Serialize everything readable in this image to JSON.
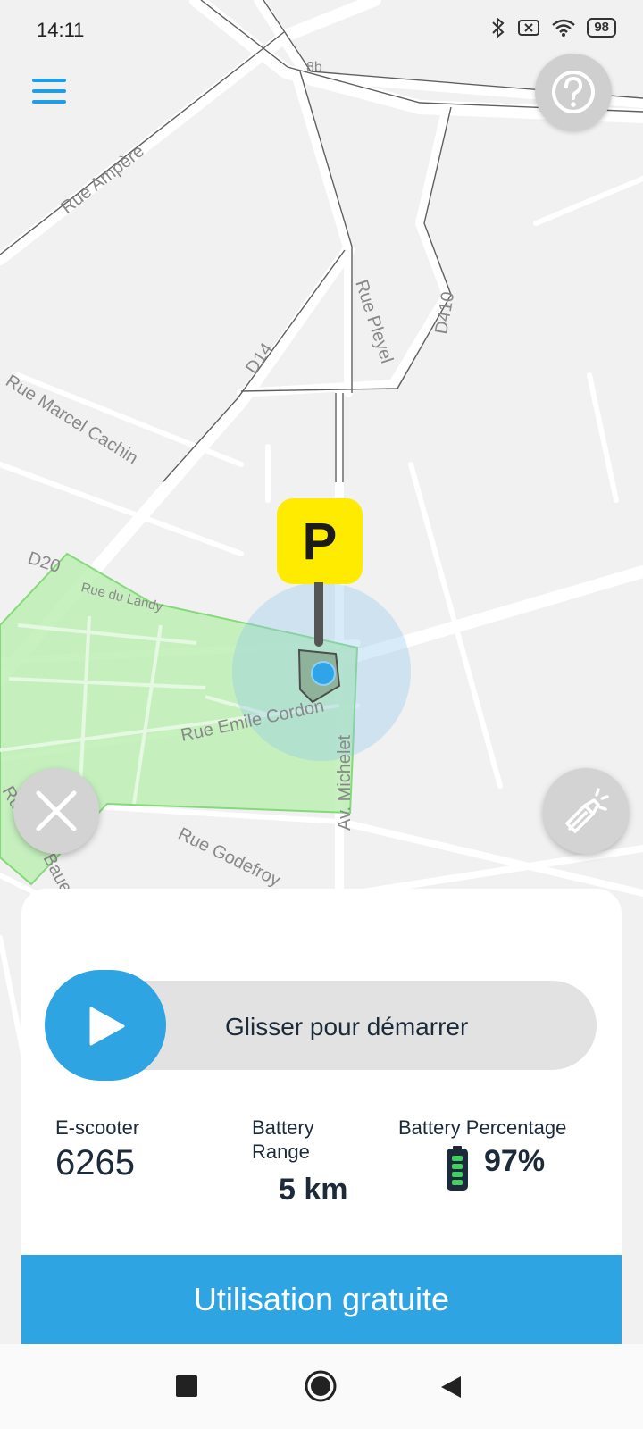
{
  "status_bar": {
    "time": "14:11",
    "battery": "98"
  },
  "map": {
    "street_labels": [
      "Rue Ampère",
      "Rue Marcel Cachin",
      "Rue Pleyel",
      "D14",
      "D410",
      "8b",
      "D20",
      "Rue du Landy",
      "Rue Emile Cordon",
      "Av. Michelet",
      "Rue Godefroy",
      "Ru",
      "Bauer"
    ]
  },
  "parking_pin": {
    "label": "P"
  },
  "panel": {
    "slider_label": "Glisser pour démarrer",
    "scooter": {
      "label": "E-scooter",
      "value": "6265"
    },
    "range": {
      "label_line1": "Battery",
      "label_line2": "Range",
      "value": "5 km"
    },
    "battery": {
      "label": "Battery Percentage",
      "value": "97%"
    },
    "cta_label": "Utilisation gratuite"
  },
  "colors": {
    "accent": "#2fa4e2",
    "parking": "#ffeb00",
    "zone": "#bdf0b5"
  }
}
